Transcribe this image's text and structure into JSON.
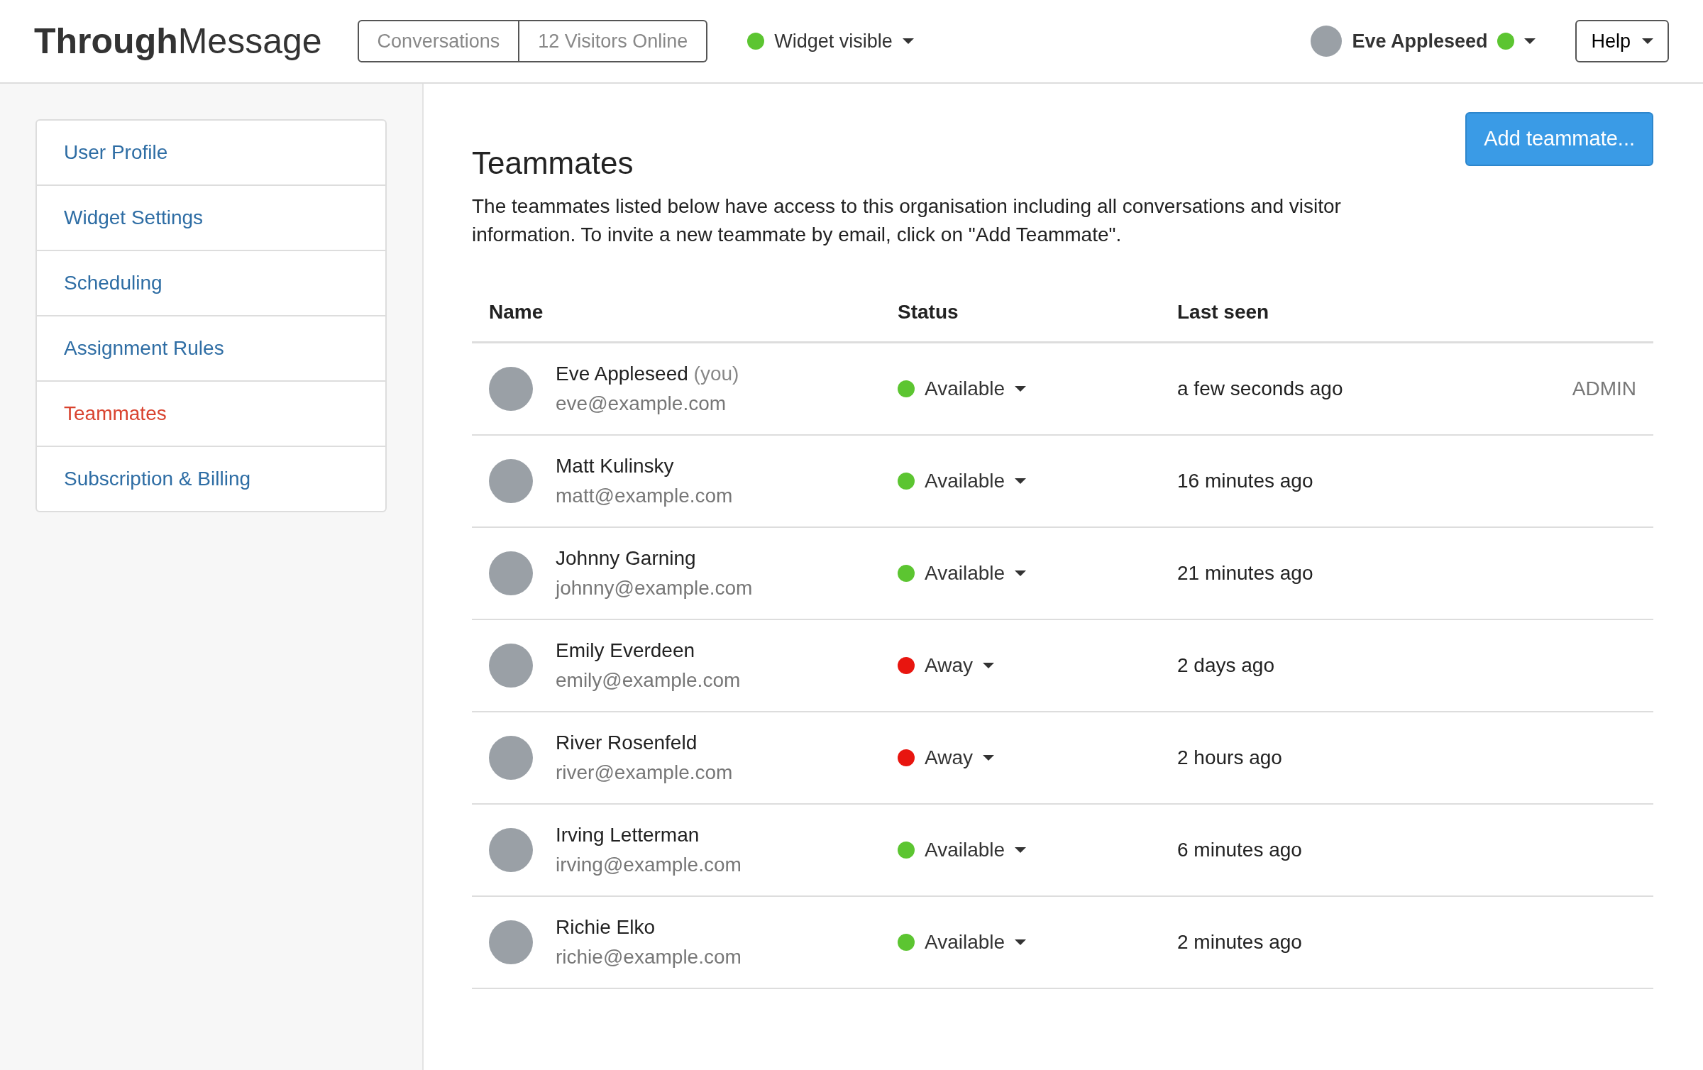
{
  "header": {
    "logo": {
      "bold": "Through",
      "light": "Message"
    },
    "nav_buttons": [
      "Conversations",
      "12 Visitors Online"
    ],
    "widget_status": {
      "label": "Widget visible",
      "color": "#5cc531"
    },
    "user": {
      "name": "Eve Appleseed",
      "color": "#5cc531"
    },
    "help": "Help"
  },
  "sidebar": {
    "items": [
      {
        "label": "User Profile",
        "selected": false
      },
      {
        "label": "Widget Settings",
        "selected": false
      },
      {
        "label": "Scheduling",
        "selected": false
      },
      {
        "label": "Assignment Rules",
        "selected": false
      },
      {
        "label": "Teammates",
        "selected": true
      },
      {
        "label": "Subscription & Billing",
        "selected": false
      }
    ]
  },
  "page": {
    "title": "Teammates",
    "add_button": "Add teammate...",
    "description": "The teammates listed below have access to this organisation including all conversations and visitor information. To invite a new teammate by email, click on \"Add Teammate\"."
  },
  "table": {
    "columns": [
      "Name",
      "Status",
      "Last seen"
    ],
    "rows": [
      {
        "name": "Eve Appleseed",
        "note": "(you)",
        "email": "eve@example.com",
        "status": "Available",
        "color": "#5cc531",
        "last_seen": "a few seconds ago",
        "role": "ADMIN"
      },
      {
        "name": "Matt Kulinsky",
        "email": "matt@example.com",
        "status": "Available",
        "color": "#5cc531",
        "last_seen": "16 minutes ago"
      },
      {
        "name": "Johnny Garning",
        "email": "johnny@example.com",
        "status": "Available",
        "color": "#5cc531",
        "last_seen": "21 minutes ago"
      },
      {
        "name": "Emily Everdeen",
        "email": "emily@example.com",
        "status": "Away",
        "color": "#e8150f",
        "last_seen": "2 days ago"
      },
      {
        "name": "River Rosenfeld",
        "email": "river@example.com",
        "status": "Away",
        "color": "#e8150f",
        "last_seen": "2 hours ago"
      },
      {
        "name": "Irving Letterman",
        "email": "irving@example.com",
        "status": "Available",
        "color": "#5cc531",
        "last_seen": "6 minutes ago"
      },
      {
        "name": "Richie Elko",
        "email": "richie@example.com",
        "status": "Available",
        "color": "#5cc531",
        "last_seen": "2 minutes ago"
      }
    ]
  }
}
